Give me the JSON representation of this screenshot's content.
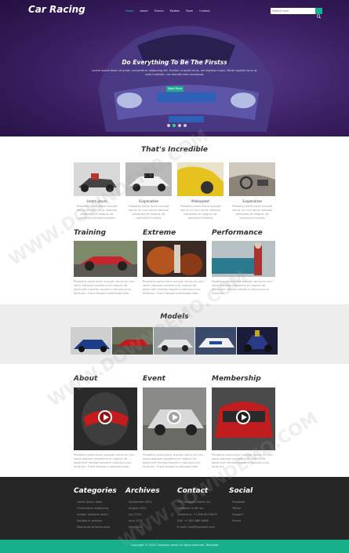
{
  "header": {
    "logo": "Car Racing",
    "nav": [
      "Home",
      "About",
      "Events",
      "Models",
      "Team",
      "Contact"
    ],
    "search_placeholder": "Search here"
  },
  "hero": {
    "title": "Do Everything To Be The Firstss",
    "text": "Lorem ipsum dolor sit amet, consectetur adipiscing elit. Nullam ut porta lacus, vel dapibus turpis. Morbi sagittis lacus at nulla molestie, non blandit odio consequat.",
    "button": "Read More"
  },
  "incredible": {
    "title": "That's Incredible",
    "items": [
      {
        "name": "Lorem ipsum",
        "text": "Phasellus porta fusce suscipit varius mi cum sociis natoque penatibus et magnis dis parturient montes nascetur"
      },
      {
        "name": "Suspendisse",
        "text": "Phasellus porta fusce suscipit varius mi cum sociis natoque penatibus et magnis dis parturient montes"
      },
      {
        "name": "Maleuqsest",
        "text": "Phasellus porta fusce suscipit varius mi cum sociis natoque penatibus et magnis dis parturient montes"
      },
      {
        "name": "Suspendisse",
        "text": "Phasellus porta fusce suscipit varius mi cum sociis natoque penatibus et magnis dis parturient montes"
      }
    ]
  },
  "columns1": [
    {
      "title": "Training",
      "text": "Phasellus porta fusce suscipit varius mi cum sociis natoque penatibus et magnis dis parturient montes nascetur ridiculus mus. Nulla dui. Fusce feugiat malesuada odio."
    },
    {
      "title": "Extreme",
      "text": "Phasellus porta fusce suscipit varius mi cum sociis natoque penatibus et magnis dis parturient montes nascetur ridiculus mus. Nulla dui. Fusce feugiat malesuada odio."
    },
    {
      "title": "Performance",
      "text": "Phasellus porta fusce suscipit varius mi cum sociis natoque penatibus et magnis dis parturient montes nascetur ridiculus mus. Nulla dui."
    }
  ],
  "models": {
    "title": "Models"
  },
  "columns2": [
    {
      "title": "About",
      "text": "Phasellus porta fusce suscipit varius mi cum sociis natoque penatibus et magnis dis parturient montes nascetur ridiculus mus. Nulla dui. Fusce feugiat malesuada odio."
    },
    {
      "title": "Event",
      "text": "Phasellus porta fusce suscipit varius mi cum sociis natoque penatibus et magnis dis parturient montes nascetur ridiculus mus. Nulla dui. Fusce feugiat malesuada odio."
    },
    {
      "title": "Membership",
      "text": "Phasellus porta fusce suscipit varius mi cum sociis natoque penatibus et magnis dis parturient montes nascetur ridiculus mus. Nulla dui."
    }
  ],
  "footer": {
    "categories": {
      "title": "Categories",
      "items": [
        "Lorem ipsum dolor",
        "Consectetur adipiscing",
        "Integer molestie lorem",
        "Facilisis in pretium",
        "Maecenas id lorem ante"
      ]
    },
    "archives": {
      "title": "Archives",
      "items": [
        "September 2014",
        "August 2014",
        "July 2014",
        "June 2014",
        "May 2014"
      ]
    },
    "contact": {
      "title": "Contact",
      "items": [
        "The Company Name Inc.",
        "Designed in 6th av,",
        "Telephone: +1 800 603 6035",
        "FAX: +1 800 889 9898",
        "E-mail: mail@example.com"
      ]
    },
    "social": {
      "title": "Social",
      "items": [
        "Facebook",
        "Twitter",
        "Google+",
        "Vimeo"
      ]
    }
  },
  "copyright": "Copyright © 2015 Company name All rights reserved. Template",
  "watermark": "WWW.DOWNDEMO.COM",
  "colors": {
    "accent": "#19b091",
    "hero": "#3b1f63",
    "footer": "#262626"
  }
}
